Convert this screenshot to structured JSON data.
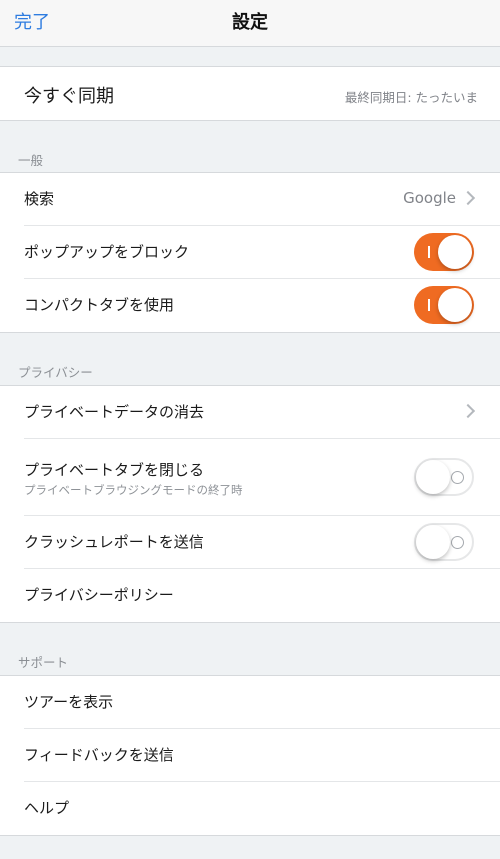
{
  "navbar": {
    "done_label": "完了",
    "title": "設定"
  },
  "sync": {
    "label": "今すぐ同期",
    "status": "最終同期日: たったいま"
  },
  "general": {
    "header": "一般",
    "search": {
      "label": "検索",
      "value": "Google"
    },
    "block_popups": {
      "label": "ポップアップをブロック",
      "enabled": true
    },
    "compact_tabs": {
      "label": "コンパクトタブを使用",
      "enabled": true
    }
  },
  "privacy": {
    "header": "プライバシー",
    "clear_private_data": {
      "label": "プライベートデータの消去"
    },
    "close_private_tabs": {
      "label": "プライベートタブを閉じる",
      "sublabel": "プライベートブラウジングモードの終了時",
      "enabled": false
    },
    "send_crash_reports": {
      "label": "クラッシュレポートを送信",
      "enabled": false
    },
    "privacy_policy": {
      "label": "プライバシーポリシー"
    }
  },
  "support": {
    "header": "サポート",
    "show_tour": {
      "label": "ツアーを表示"
    },
    "send_feedback": {
      "label": "フィードバックを送信"
    },
    "help": {
      "label": "ヘルプ"
    }
  },
  "colors": {
    "accent": "#ef6b22",
    "link": "#2e7ce0",
    "background": "#eff2f4"
  }
}
